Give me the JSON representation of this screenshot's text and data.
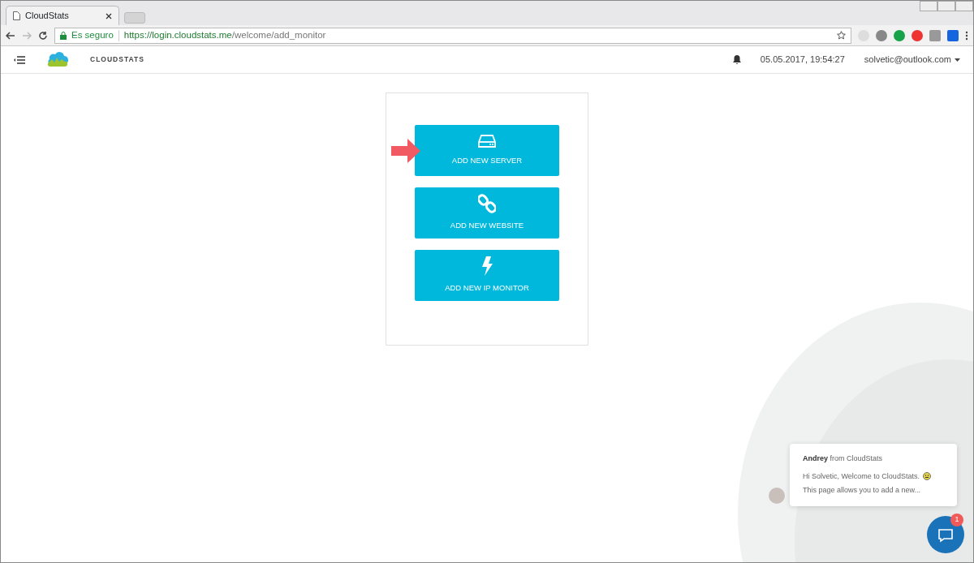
{
  "browser": {
    "tab_title": "CloudStats",
    "secure_label": "Es seguro",
    "url_host": "https://login.cloudstats.me",
    "url_path": "/welcome/add_monitor"
  },
  "header": {
    "brand": "CLOUDSTATS",
    "datetime": "05.05.2017, 19:54:27",
    "user": "solvetic@outlook.com"
  },
  "actions": [
    {
      "kind": "server",
      "label": "ADD NEW SERVER",
      "pointed": true
    },
    {
      "kind": "website",
      "label": "ADD NEW WEBSITE",
      "pointed": false
    },
    {
      "kind": "ip",
      "label": "ADD NEW IP MONITOR",
      "pointed": false
    }
  ],
  "chat": {
    "sender": "Andrey",
    "sender_suffix": "from CloudStats",
    "lines": [
      "Hi Solvetic, Welcome to CloudStats.",
      "This page allows you to add a new..."
    ],
    "unread": "1"
  }
}
